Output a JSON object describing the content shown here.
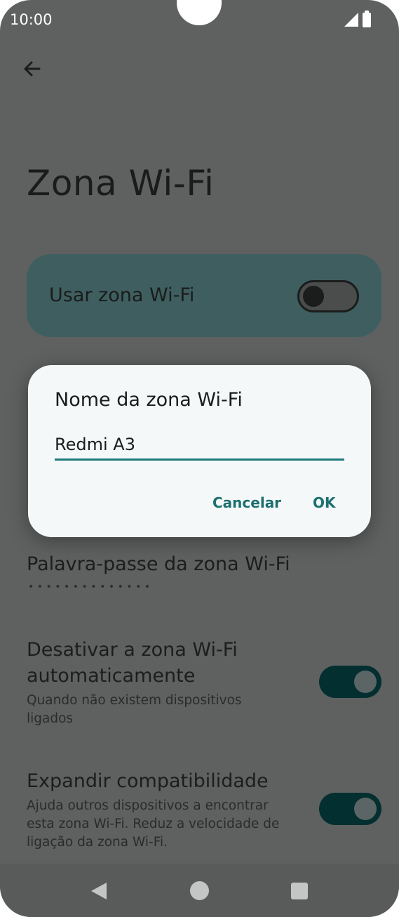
{
  "status_bar": {
    "time": "10:00"
  },
  "page": {
    "title": "Zona Wi-Fi"
  },
  "main_toggle": {
    "label": "Usar zona Wi-Fi",
    "on": false
  },
  "dialog": {
    "title": "Nome da zona Wi-Fi",
    "input_value": "Redmi A3",
    "cancel_label": "Cancelar",
    "ok_label": "OK"
  },
  "settings": {
    "password": {
      "title": "Palavra-passe da zona Wi-Fi",
      "masked_value": "••••••••••••••"
    },
    "auto_off": {
      "title_line1": "Desativar a zona Wi-Fi",
      "title_line2": "automaticamente",
      "subtitle_line1": "Quando não existem dispositivos",
      "subtitle_line2": "ligados",
      "on": true
    },
    "compat": {
      "title": "Expandir compatibilidade",
      "subtitle_line1": "Ajuda outros dispositivos a encontrar",
      "subtitle_line2": "esta zona Wi-Fi. Reduz a velocidade de",
      "subtitle_line3": "ligação da zona Wi-Fi.",
      "on": true
    }
  },
  "icons": {
    "back": "arrow-left-icon",
    "signal": "signal-icon",
    "battery": "battery-icon",
    "nav_back": "nav-back-icon",
    "nav_home": "nav-home-icon",
    "nav_recent": "nav-recents-icon"
  },
  "colors": {
    "scrim_background": "#5f6161",
    "card": "#3f5e5f",
    "accent": "#1e7a7c",
    "switch_on": "#042f30",
    "dialog": "#f4f8f8"
  }
}
